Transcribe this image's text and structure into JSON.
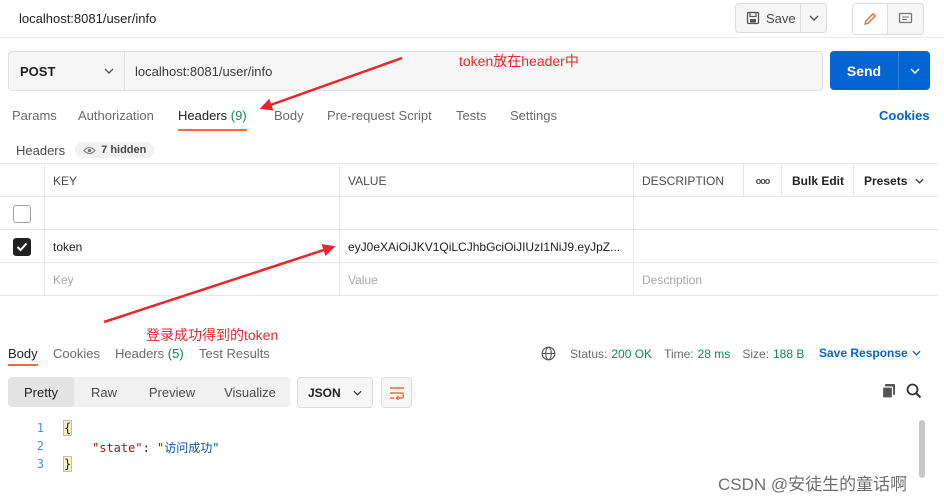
{
  "top": {
    "title": "localhost:8081/user/info",
    "save_label": "Save"
  },
  "request": {
    "method": "POST",
    "url": "localhost:8081/user/info",
    "send_label": "Send"
  },
  "req_tabs": [
    {
      "label": "Params"
    },
    {
      "label": "Authorization"
    },
    {
      "label": "Headers",
      "count": "(9)"
    },
    {
      "label": "Body"
    },
    {
      "label": "Pre-request Script"
    },
    {
      "label": "Tests"
    },
    {
      "label": "Settings"
    }
  ],
  "cookies_label": "Cookies",
  "headers_sub": {
    "label": "Headers",
    "hidden": "7 hidden"
  },
  "table": {
    "columns": {
      "key": "KEY",
      "value": "VALUE",
      "description": "DESCRIPTION",
      "more": "ooo",
      "bulk_edit": "Bulk Edit",
      "presets": "Presets"
    },
    "rows": [
      {
        "key": "",
        "value": "",
        "description": ""
      },
      {
        "key": "token",
        "value": "eyJ0eXAiOiJKV1QiLCJhbGciOiJIUzI1NiJ9.eyJpZ...",
        "description": ""
      }
    ],
    "placeholders": {
      "key": "Key",
      "value": "Value",
      "description": "Description"
    }
  },
  "annotations": {
    "header_note": "token放在header中",
    "token_note": "登录成功得到的token"
  },
  "resp_tabs": [
    {
      "label": "Body"
    },
    {
      "label": "Cookies"
    },
    {
      "label": "Headers",
      "count": "(5)"
    },
    {
      "label": "Test Results"
    }
  ],
  "response": {
    "status_label": "Status:",
    "status_value": "200 OK",
    "time_label": "Time:",
    "time_value": "28 ms",
    "size_label": "Size:",
    "size_value": "188 B",
    "save_label": "Save Response"
  },
  "view_modes": [
    "Pretty",
    "Raw",
    "Preview",
    "Visualize"
  ],
  "format": "JSON",
  "code": {
    "line_numbers": [
      "1",
      "2",
      "3"
    ],
    "open": "{",
    "key": "\"state\"",
    "colon": ": ",
    "value": "\"访问成功\"",
    "close": "}"
  },
  "watermark": "CSDN @安徒生的童话啊",
  "colors": {
    "accent": "#f26b3a",
    "brand_blue": "#0265d2",
    "success": "#0c8a52",
    "annotation": "#e8262c"
  }
}
